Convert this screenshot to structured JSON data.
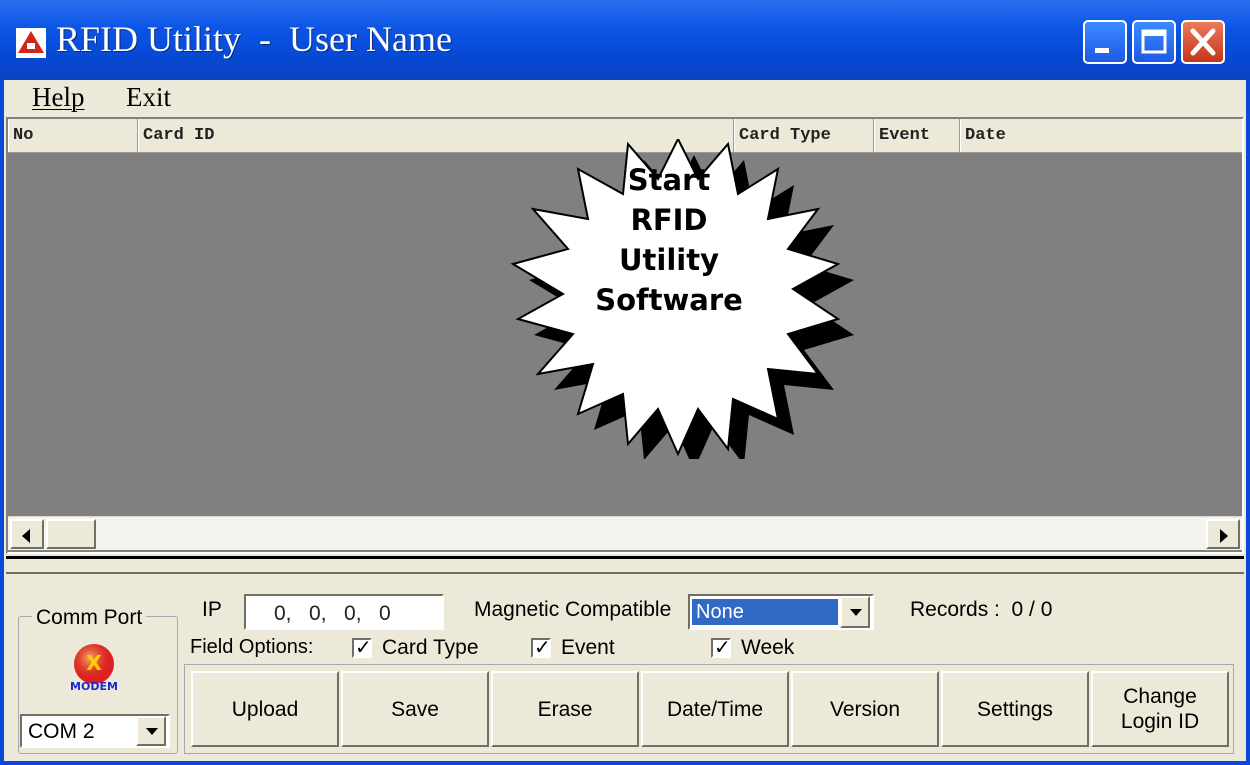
{
  "window": {
    "title": "RFID Utility  -  User Name",
    "icon": "triangle-app-icon",
    "title_bar_color": "#0c55e6"
  },
  "menu": {
    "help": "Help",
    "exit": "Exit"
  },
  "grid": {
    "columns": [
      "No",
      "Card ID",
      "Card Type",
      "Event",
      "Date"
    ]
  },
  "callout": {
    "lines": [
      "Start",
      "RFID",
      "Utility",
      "Software"
    ]
  },
  "panel": {
    "comm_port_label": "Comm Port",
    "modem_icon": "modem-icon",
    "com_value": "COM 2",
    "ip_label": "IP",
    "ip_value": "0,   0,   0,   0",
    "magnetic_label": "Magnetic Compatible",
    "magnetic_value": "None",
    "records_label": "Records :  0 / 0",
    "field_options_label": "Field Options:",
    "checkboxes": [
      {
        "label": "Card Type",
        "checked": true
      },
      {
        "label": "Event",
        "checked": true
      },
      {
        "label": "Week",
        "checked": true
      }
    ],
    "buttons": [
      "Upload",
      "Save",
      "Erase",
      "Date/Time",
      "Version",
      "Settings",
      "Change\nLogin ID"
    ]
  }
}
